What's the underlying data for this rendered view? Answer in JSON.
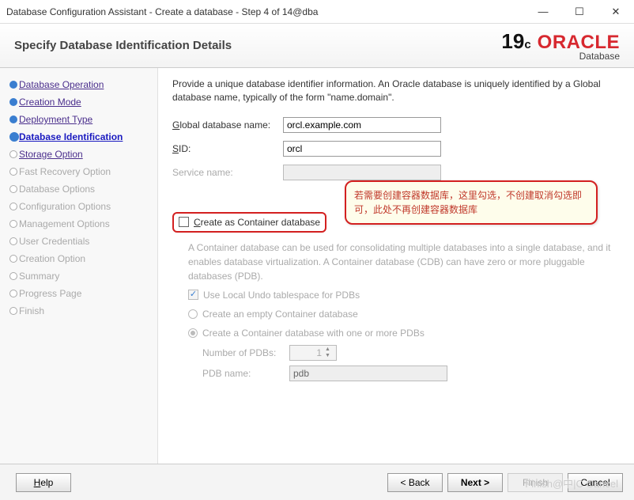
{
  "window": {
    "title": "Database Configuration Assistant - Create a database - Step 4 of 14@dba"
  },
  "header": {
    "title": "Specify Database Identification Details",
    "logo_version": "19",
    "logo_suffix": "c",
    "logo_brand": "ORACLE",
    "logo_sub": "Database"
  },
  "nav": [
    {
      "label": "Database Operation",
      "state": "done-link"
    },
    {
      "label": "Creation Mode",
      "state": "done-link"
    },
    {
      "label": "Deployment Type",
      "state": "done-link"
    },
    {
      "label": "Database Identification",
      "state": "current"
    },
    {
      "label": "Storage Option",
      "state": "next-link"
    },
    {
      "label": "Fast Recovery Option",
      "state": "disabled"
    },
    {
      "label": "Database Options",
      "state": "disabled"
    },
    {
      "label": "Configuration Options",
      "state": "disabled"
    },
    {
      "label": "Management Options",
      "state": "disabled"
    },
    {
      "label": "User Credentials",
      "state": "disabled"
    },
    {
      "label": "Creation Option",
      "state": "disabled"
    },
    {
      "label": "Summary",
      "state": "disabled"
    },
    {
      "label": "Progress Page",
      "state": "disabled"
    },
    {
      "label": "Finish",
      "state": "disabled"
    }
  ],
  "intro": "Provide a unique database identifier information. An Oracle database is uniquely identified by a Global database name, typically of the form \"name.domain\".",
  "fields": {
    "global_label": "Global database name:",
    "global_value": "orcl.example.com",
    "sid_label": "SID:",
    "sid_value": "orcl",
    "service_label": "Service name:",
    "service_value": ""
  },
  "container": {
    "checkbox_label": "Create as Container database",
    "callout": "若需要创建容器数据库，这里勾选，不创建取消勾选即可，此处不再创建容器数据库",
    "desc": "A Container database can be used for consolidating multiple databases into a single database, and it enables database virtualization. A Container database (CDB) can have zero or more pluggable databases (PDB).",
    "use_local_undo": "Use Local Undo tablespace for PDBs",
    "empty_container": "Create an empty Container database",
    "with_pdbs": "Create a Container database with one or more PDBs",
    "num_pdbs_label": "Number of PDBs:",
    "num_pdbs_value": "1",
    "pdb_name_label": "PDB name:",
    "pdb_name_value": "pdb"
  },
  "footer": {
    "help": "Help",
    "back": "< Back",
    "next": "Next >",
    "finish": "Finish",
    "cancel": "Cancel"
  },
  "watermark": "Finish@中|C Cancel"
}
